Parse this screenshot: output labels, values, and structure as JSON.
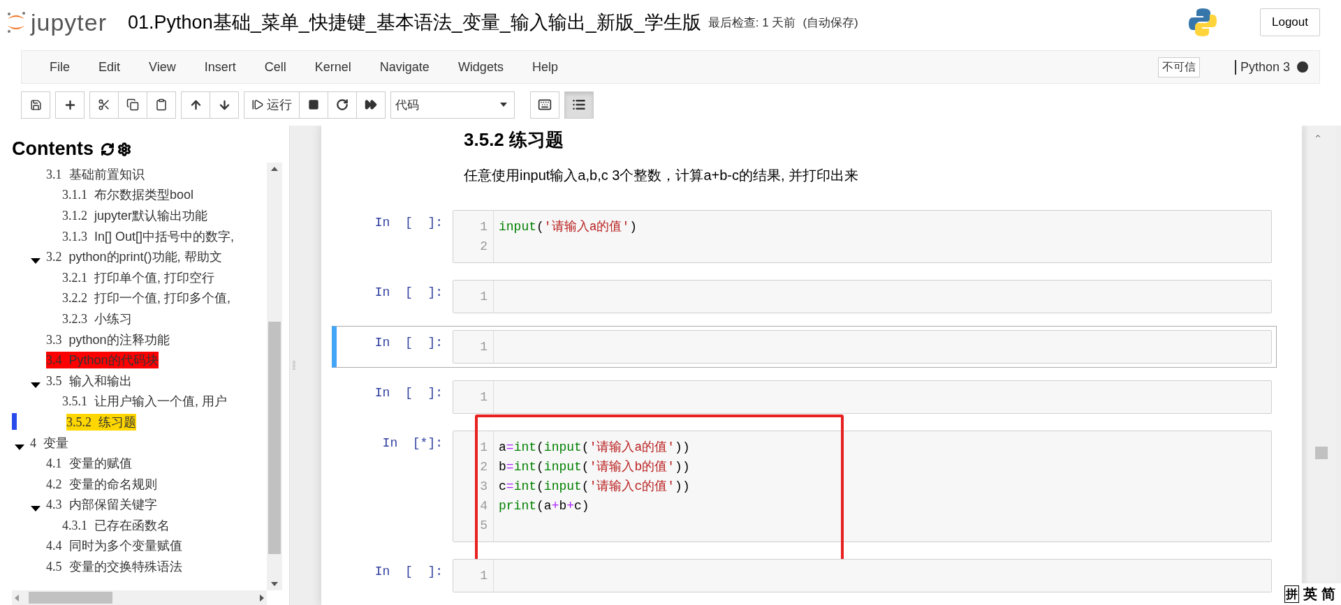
{
  "header": {
    "logo_text": "jupyter",
    "notebook_name": "01.Python基础_菜单_快捷键_基本语法_变量_输入输出_新版_学生版",
    "checkpoint": "最后检查: 1 天前",
    "autosave": "(自动保存)",
    "logout": "Logout"
  },
  "menu": [
    "File",
    "Edit",
    "View",
    "Insert",
    "Cell",
    "Kernel",
    "Navigate",
    "Widgets",
    "Help"
  ],
  "trust_badge": "不可信",
  "kernel": {
    "name": "Python 3",
    "busy": true
  },
  "toolbar": {
    "run_label": "运行",
    "cell_type": "代码",
    "toc_active": true
  },
  "toc": {
    "title": "Contents",
    "items": [
      {
        "children": [
          {
            "number": "3.1",
            "title": "基础前置知识",
            "children": [
              {
                "number": "3.1.1",
                "title": "布尔数据类型bool"
              },
              {
                "number": "3.1.2",
                "title": "jupyter默认输出功能"
              },
              {
                "number": "3.1.3",
                "title": "In[] Out[]中括号中的数字,"
              }
            ]
          },
          {
            "number": "3.2",
            "title": "python的print()功能, 帮助文",
            "expanded": true,
            "children": [
              {
                "number": "3.2.1",
                "title": "打印单个值, 打印空行"
              },
              {
                "number": "3.2.2",
                "title": "打印一个值, 打印多个值,"
              },
              {
                "number": "3.2.3",
                "title": "小练习"
              }
            ]
          },
          {
            "number": "3.3",
            "title": "python的注释功能"
          },
          {
            "number": "3.4",
            "title": "Python的代码块",
            "color": "#ff0000"
          },
          {
            "number": "3.5",
            "title": "输入和输出",
            "expanded": true,
            "children": [
              {
                "number": "3.5.1",
                "title": "让用户输入一个值, 用户"
              },
              {
                "number": "3.5.2",
                "title": "练习题",
                "color": "#ffd700",
                "selected": true
              }
            ]
          }
        ]
      },
      {
        "number": "4",
        "title": "变量",
        "expanded": true,
        "children": [
          {
            "number": "4.1",
            "title": "变量的赋值"
          },
          {
            "number": "4.2",
            "title": "变量的命名规则"
          },
          {
            "number": "4.3",
            "title": "内部保留关键字",
            "expanded": true,
            "children": [
              {
                "number": "4.3.1",
                "title": "已存在函数名"
              }
            ]
          },
          {
            "number": "4.4",
            "title": "同时为多个变量赋值"
          },
          {
            "number": "4.5",
            "title": "变量的交换特殊语法"
          }
        ]
      }
    ]
  },
  "notebook": {
    "heading": "3.5.2  练习题",
    "paragraph": "任意使用input输入a,b,c 3个整数，计算a+b-c的结果, 并打印出来",
    "cells": [
      {
        "prompt": "In  [  ]:",
        "selected": false,
        "boxed": false,
        "lines": [
          {
            "number": "1",
            "tokens": [
              {
                "kind": "builtin",
                "text": "input"
              },
              {
                "kind": "plain",
                "text": "("
              },
              {
                "kind": "string",
                "text": "'请输入a的值'"
              },
              {
                "kind": "plain",
                "text": ")"
              }
            ]
          },
          {
            "number": "2"
          }
        ]
      },
      {
        "prompt": "In  [  ]:",
        "selected": false,
        "boxed": false,
        "lines": [
          {
            "number": "1"
          }
        ]
      },
      {
        "prompt": "In  [  ]:",
        "selected": true,
        "boxed": false,
        "lines": [
          {
            "number": "1"
          }
        ]
      },
      {
        "prompt": "In  [  ]:",
        "selected": false,
        "boxed": false,
        "lines": [
          {
            "number": "1"
          }
        ]
      },
      {
        "prompt": "In  [*]:",
        "selected": false,
        "boxed": true,
        "lines": [
          {
            "number": "1",
            "tokens": [
              {
                "kind": "plain",
                "text": "a"
              },
              {
                "kind": "op",
                "text": "="
              },
              {
                "kind": "builtin",
                "text": "int"
              },
              {
                "kind": "plain",
                "text": "("
              },
              {
                "kind": "builtin",
                "text": "input"
              },
              {
                "kind": "plain",
                "text": "("
              },
              {
                "kind": "string",
                "text": "'请输入a的值'"
              },
              {
                "kind": "plain",
                "text": "))"
              }
            ]
          },
          {
            "number": "2",
            "tokens": [
              {
                "kind": "plain",
                "text": "b"
              },
              {
                "kind": "op",
                "text": "="
              },
              {
                "kind": "builtin",
                "text": "int"
              },
              {
                "kind": "plain",
                "text": "("
              },
              {
                "kind": "builtin",
                "text": "input"
              },
              {
                "kind": "plain",
                "text": "("
              },
              {
                "kind": "string",
                "text": "'请输入b的值'"
              },
              {
                "kind": "plain",
                "text": "))"
              }
            ]
          },
          {
            "number": "3",
            "tokens": [
              {
                "kind": "plain",
                "text": "c"
              },
              {
                "kind": "op",
                "text": "="
              },
              {
                "kind": "builtin",
                "text": "int"
              },
              {
                "kind": "plain",
                "text": "("
              },
              {
                "kind": "builtin",
                "text": "input"
              },
              {
                "kind": "plain",
                "text": "("
              },
              {
                "kind": "string",
                "text": "'请输入c的值'"
              },
              {
                "kind": "plain",
                "text": "))"
              }
            ]
          },
          {
            "number": "4",
            "tokens": [
              {
                "kind": "builtin",
                "text": "print"
              },
              {
                "kind": "plain",
                "text": "(a"
              },
              {
                "kind": "op",
                "text": "+"
              },
              {
                "kind": "plain",
                "text": "b"
              },
              {
                "kind": "op",
                "text": "+"
              },
              {
                "kind": "plain",
                "text": "c)"
              }
            ]
          },
          {
            "number": "5"
          }
        ]
      },
      {
        "prompt": "In  [  ]:",
        "selected": false,
        "boxed": false,
        "lines": [
          {
            "number": "1"
          }
        ]
      }
    ]
  },
  "ime_bar": [
    "拼",
    "英",
    "简"
  ]
}
